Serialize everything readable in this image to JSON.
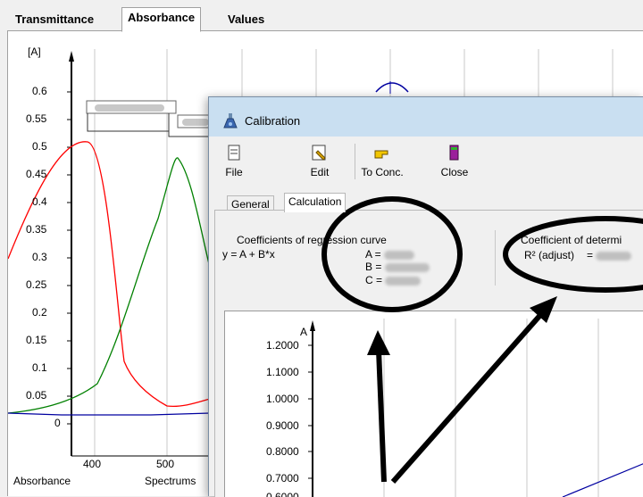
{
  "main_tabs": [
    "Transmittance",
    "Absorbance",
    "Values"
  ],
  "spectrum": {
    "y_unit": "[A]",
    "y_ticks": [
      "0.6",
      "0.55",
      "0.5",
      "0.45",
      "0.4",
      "0.35",
      "0.3",
      "0.25",
      "0.2",
      "0.15",
      "0.1",
      "0.05",
      "0"
    ],
    "x_ticks": [
      "400",
      "500"
    ],
    "footer_left": "Absorbance",
    "footer_right": "Spectrums",
    "series_colors": [
      "#ff0000",
      "#008000",
      "#0000a0"
    ]
  },
  "dialog": {
    "title": "Calibration",
    "toolbar": [
      "File",
      "Edit",
      "To Conc.",
      "Close"
    ],
    "tabs": [
      "General",
      "Calculation"
    ],
    "regression": {
      "heading": "Coefficients of regression curve",
      "formula": "y = A + B*x",
      "a": "A =",
      "b": "B =",
      "c": "C ="
    },
    "determination": {
      "heading": "Coefficient of determi",
      "label": "R² (adjust)",
      "eq": "="
    },
    "graph": {
      "y_label": "A",
      "y_ticks": [
        "1.2000",
        "1.1000",
        "1.0000",
        "0.9000",
        "0.8000",
        "0.7000",
        "0.6000"
      ]
    }
  }
}
